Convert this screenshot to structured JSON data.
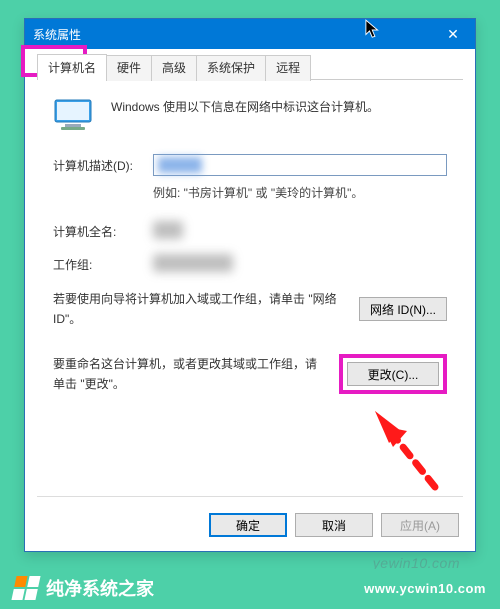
{
  "window": {
    "title": "系统属性",
    "close_glyph": "✕"
  },
  "tabs": {
    "t0": "计算机名",
    "t1": "硬件",
    "t2": "高级",
    "t3": "系统保护",
    "t4": "远程"
  },
  "info_line": "Windows 使用以下信息在网络中标识这台计算机。",
  "desc_label": "计算机描述(D):",
  "example_text": "例如: \"书房计算机\" 或 \"美玲的计算机\"。",
  "fullname_label": "计算机全名:",
  "workgroup_label": "工作组:",
  "netid_text": "若要使用向导将计算机加入域或工作组，请单击 \"网络 ID\"。",
  "netid_btn": "网络 ID(N)...",
  "change_text": "要重命名这台计算机，或者更改其域或工作组，请单击 \"更改\"。",
  "change_btn": "更改(C)...",
  "footer": {
    "ok": "确定",
    "cancel": "取消",
    "apply": "应用(A)"
  },
  "brand": {
    "name": "纯净系统之家",
    "url": "www.ycwin10.com"
  },
  "watermark": "yewin10.com"
}
